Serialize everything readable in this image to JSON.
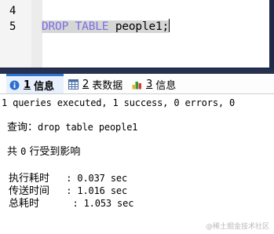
{
  "editor": {
    "line_numbers": [
      "4",
      "5"
    ],
    "code_keyword": "DROP TABLE",
    "code_identifier": "people1;"
  },
  "tabs": [
    {
      "num": "1",
      "label": "信息",
      "icon": "info-icon",
      "active": true
    },
    {
      "num": "2",
      "label": "表数据",
      "icon": "table-grid-icon",
      "active": false
    },
    {
      "num": "3",
      "label": "信息",
      "icon": "profile-chart-icon",
      "active": false
    }
  ],
  "result": {
    "summary": "1 queries executed, 1 success, 0 errors, 0",
    "query_label": "查询：",
    "query_text": "drop table people1",
    "affected_pre": "共 ",
    "affected_count": "0",
    "affected_post": " 行受到影响",
    "timings": [
      {
        "label": "执行耗时",
        "value": "   : 0.037 sec"
      },
      {
        "label": "传送时间",
        "value": "   : 1.016 sec"
      },
      {
        "label": "总耗时",
        "value": "      : 1.053 sec"
      }
    ]
  },
  "watermark": "@稀土掘金技术社区",
  "colors": {
    "keyword": "#7a6fe0",
    "selection": "#d6d6d6",
    "dark_chrome": "#27314f",
    "active_tab_bg": "#e7f0fc",
    "active_tab_accent": "#2f74cf"
  }
}
